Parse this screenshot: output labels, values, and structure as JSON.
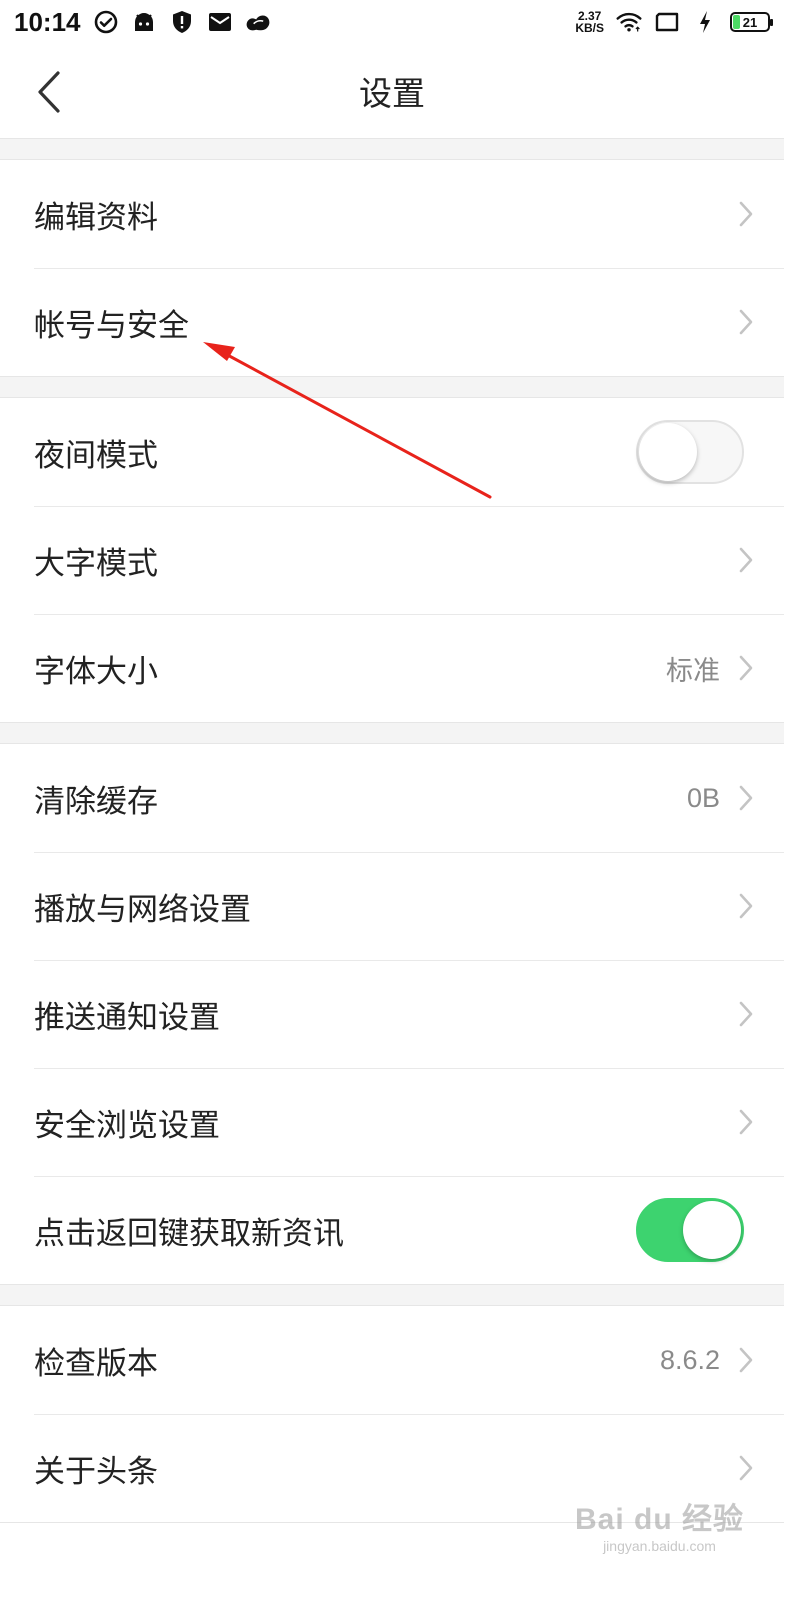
{
  "status_bar": {
    "time": "10:14",
    "net_speed_value": "2.37",
    "net_speed_unit": "KB/S",
    "battery": "21",
    "icons": [
      "check-circle-icon",
      "android-icon",
      "shield-alert-icon",
      "mail-icon",
      "app-blob-icon",
      "wifi-icon",
      "screen-icon",
      "charging-icon"
    ]
  },
  "nav": {
    "title": "设置",
    "back_icon": "chevron-left-icon"
  },
  "settings": {
    "groups": [
      {
        "items": [
          {
            "label": "编辑资料"
          },
          {
            "label": "帐号与安全"
          }
        ]
      },
      {
        "items": [
          {
            "label": "夜间模式",
            "toggle": false
          },
          {
            "label": "大字模式"
          },
          {
            "label": "字体大小",
            "value": "标准"
          }
        ]
      },
      {
        "items": [
          {
            "label": "清除缓存",
            "value": "0B"
          },
          {
            "label": "播放与网络设置"
          },
          {
            "label": "推送通知设置"
          },
          {
            "label": "安全浏览设置"
          },
          {
            "label": "点击返回键获取新资讯",
            "toggle": true
          }
        ]
      },
      {
        "items": [
          {
            "label": "检查版本",
            "value": "8.6.2"
          },
          {
            "label": "关于头条"
          }
        ]
      }
    ]
  },
  "colors": {
    "toggle_on": "#3dd36f",
    "annotation_arrow": "#e8231b",
    "background_gap": "#f4f4f4"
  },
  "watermark": {
    "brand": "Bai du 经验",
    "url": "jingyan.baidu.com"
  }
}
